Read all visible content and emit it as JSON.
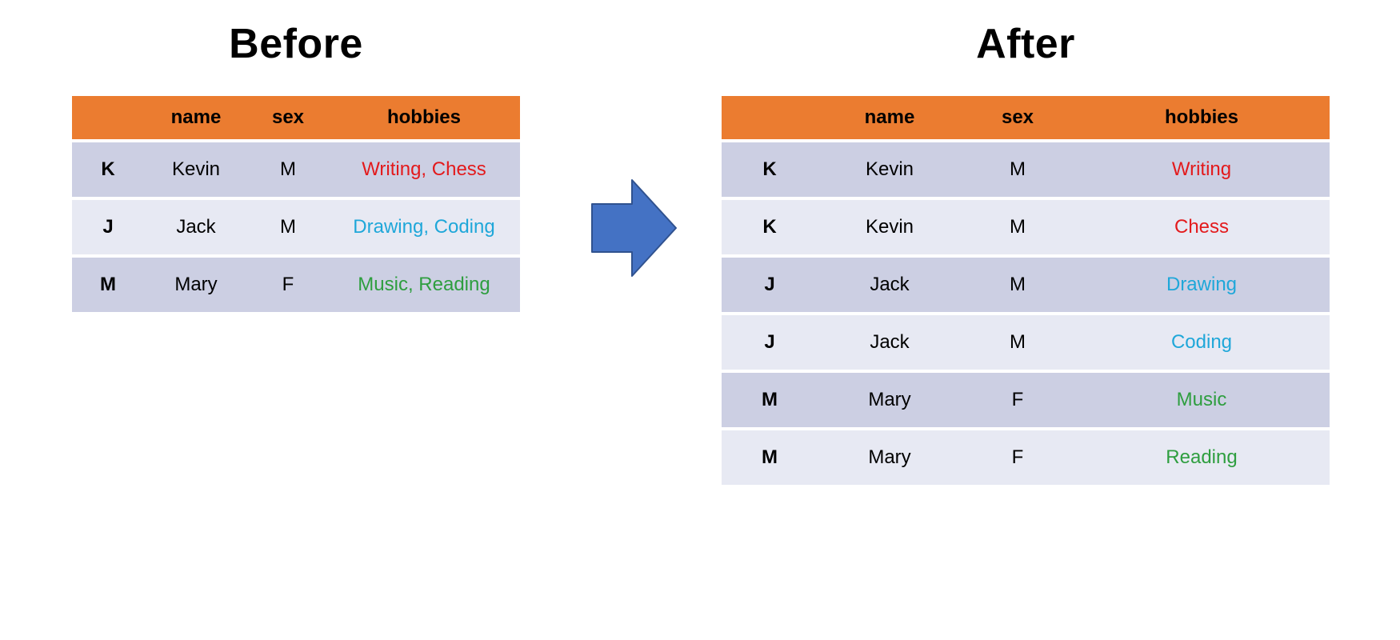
{
  "titles": {
    "before": "Before",
    "after": "After"
  },
  "columns": {
    "index": "",
    "name": "name",
    "sex": "sex",
    "hobbies": "hobbies"
  },
  "colors": {
    "header_bg": "#eb7c30",
    "row_odd": "#cccfe3",
    "row_even": "#e7e9f3",
    "red": "#e31a1c",
    "blue": "#1fa7d9",
    "green": "#2e9e3f",
    "arrow": "#4472c4",
    "arrow_stroke": "#30528f"
  },
  "before_rows": [
    {
      "idx": "K",
      "name": "Kevin",
      "sex": "M",
      "hobbies": "Writing, Chess",
      "color_class": "c-red"
    },
    {
      "idx": "J",
      "name": "Jack",
      "sex": "M",
      "hobbies": "Drawing, Coding",
      "color_class": "c-blue"
    },
    {
      "idx": "M",
      "name": "Mary",
      "sex": "F",
      "hobbies": "Music, Reading",
      "color_class": "c-green"
    }
  ],
  "after_rows": [
    {
      "idx": "K",
      "name": "Kevin",
      "sex": "M",
      "hobbies": "Writing",
      "color_class": "c-red"
    },
    {
      "idx": "K",
      "name": "Kevin",
      "sex": "M",
      "hobbies": "Chess",
      "color_class": "c-red"
    },
    {
      "idx": "J",
      "name": "Jack",
      "sex": "M",
      "hobbies": "Drawing",
      "color_class": "c-blue"
    },
    {
      "idx": "J",
      "name": "Jack",
      "sex": "M",
      "hobbies": "Coding",
      "color_class": "c-blue"
    },
    {
      "idx": "M",
      "name": "Mary",
      "sex": "F",
      "hobbies": "Music",
      "color_class": "c-green"
    },
    {
      "idx": "M",
      "name": "Mary",
      "sex": "F",
      "hobbies": "Reading",
      "color_class": "c-green"
    }
  ],
  "chart_data": {
    "type": "table",
    "description": "Illustration of exploding a comma-separated 'hobbies' column into one row per hobby (pandas df.explode behaviour).",
    "before": {
      "index": [
        "K",
        "J",
        "M"
      ],
      "columns": [
        "name",
        "sex",
        "hobbies"
      ],
      "data": [
        [
          "Kevin",
          "M",
          "Writing, Chess"
        ],
        [
          "Jack",
          "M",
          "Drawing, Coding"
        ],
        [
          "Mary",
          "F",
          "Music, Reading"
        ]
      ]
    },
    "after": {
      "index": [
        "K",
        "K",
        "J",
        "J",
        "M",
        "M"
      ],
      "columns": [
        "name",
        "sex",
        "hobbies"
      ],
      "data": [
        [
          "Kevin",
          "M",
          "Writing"
        ],
        [
          "Kevin",
          "M",
          "Chess"
        ],
        [
          "Jack",
          "M",
          "Drawing"
        ],
        [
          "Jack",
          "M",
          "Coding"
        ],
        [
          "Mary",
          "F",
          "Music"
        ],
        [
          "Mary",
          "F",
          "Reading"
        ]
      ]
    }
  }
}
